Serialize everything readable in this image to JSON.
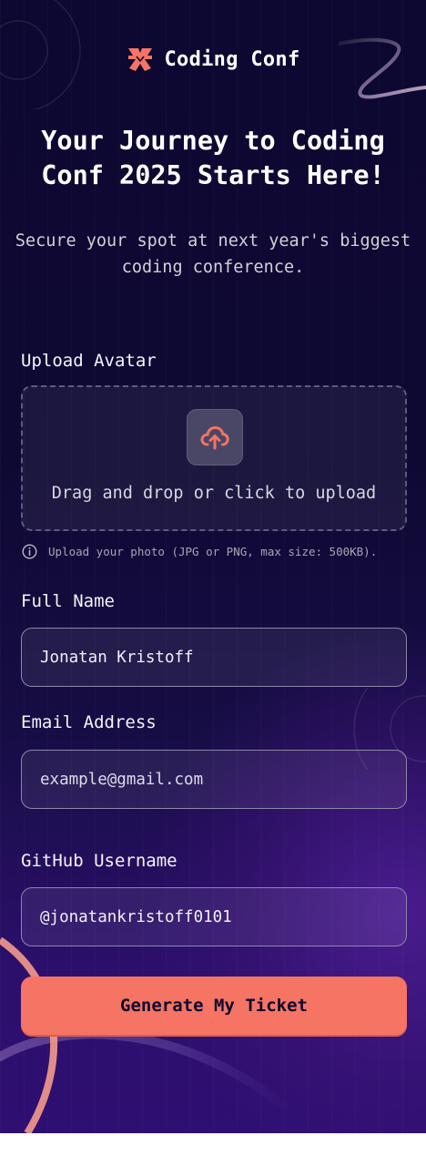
{
  "brand": {
    "logo_text": "Coding Conf",
    "accent": "#f57463"
  },
  "hero": {
    "title": "Your Journey to Coding Conf 2025 Starts Here!",
    "subtitle": "Secure your spot at next year's biggest coding conference."
  },
  "form": {
    "avatar": {
      "label": "Upload Avatar",
      "dropzone_text": "Drag and drop or click to upload",
      "hint": "Upload your photo (JPG or PNG, max size: 500KB).",
      "upload_icon": "cloud-upload-icon",
      "info_icon": "info-icon"
    },
    "full_name": {
      "label": "Full Name",
      "value": "Jonatan Kristoff"
    },
    "email": {
      "label": "Email Address",
      "placeholder": "example@gmail.com"
    },
    "github": {
      "label": "GitHub Username",
      "value": "@jonatankristoff0101"
    },
    "submit_label": "Generate My Ticket"
  }
}
